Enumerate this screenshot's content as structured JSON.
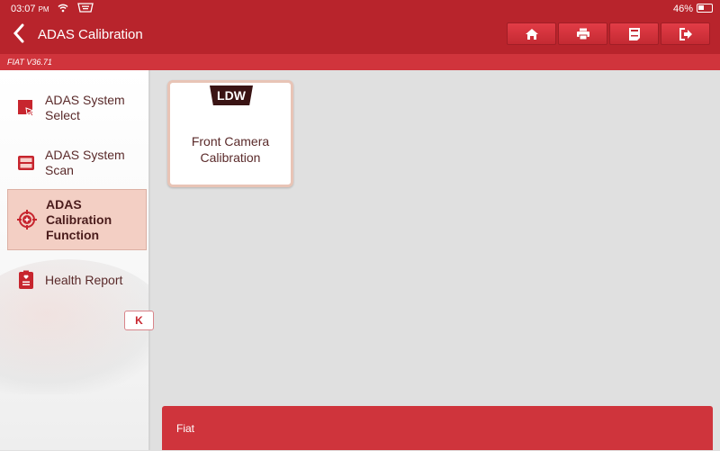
{
  "status_bar": {
    "time": "03:07",
    "ampm": "PM",
    "battery_percent": "46%",
    "battery_level": 0.46
  },
  "header": {
    "title": "ADAS Calibration",
    "toolbar": [
      {
        "icon": "home-icon",
        "label": "Home"
      },
      {
        "icon": "print-icon",
        "label": "Print"
      },
      {
        "icon": "adas-report-icon",
        "label": "ADAS"
      },
      {
        "icon": "exit-icon",
        "label": "Exit"
      }
    ]
  },
  "subheader": {
    "version": "FIAT V36.71"
  },
  "sidebar": {
    "items": [
      {
        "label": "ADAS System Select",
        "icon": "cursor-select-icon",
        "active": false
      },
      {
        "label": "ADAS System Scan",
        "icon": "scan-icon",
        "active": false
      },
      {
        "label": "ADAS Calibration Function",
        "icon": "target-icon",
        "active": true
      },
      {
        "label": "Health Report",
        "icon": "clipboard-health-icon",
        "active": false
      }
    ],
    "collapse_label": "K"
  },
  "main": {
    "cards": [
      {
        "badge": "LDW",
        "title": "Front Camera Calibration"
      }
    ]
  },
  "footer": {
    "label": "Fiat"
  },
  "colors": {
    "header_red": "#b8242c",
    "subbar_red": "#d0343c",
    "active_bg": "#f3cfc4",
    "text_dark": "#5a2a2a"
  }
}
